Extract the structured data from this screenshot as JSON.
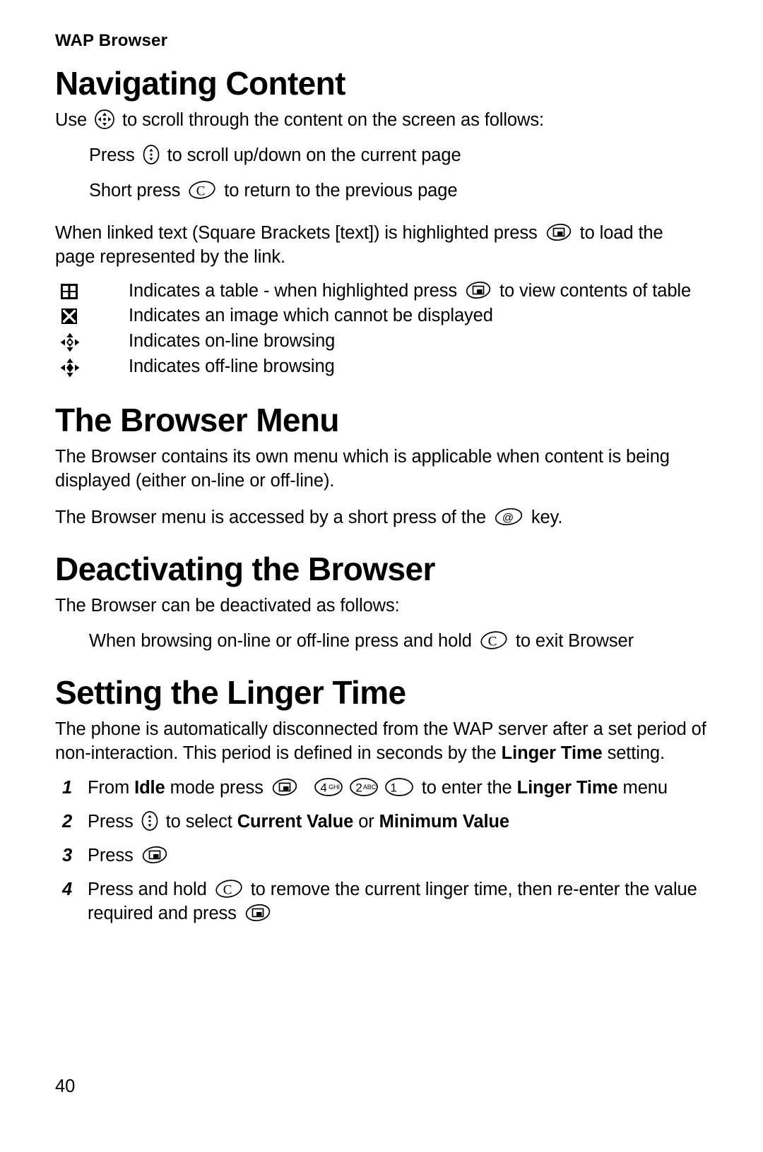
{
  "page": {
    "running_head": "WAP Browser",
    "page_number": "40"
  },
  "sections": [
    {
      "id": "navigating-content",
      "heading": "Navigating Content",
      "intro_before": "Use ",
      "intro_after": " to scroll through the content on the screen as follows:",
      "indent_items": [
        {
          "before": "Press ",
          "after": " to scroll up/down on the current page",
          "key": "updown"
        },
        {
          "before": "Short press ",
          "after": " to return to the previous page",
          "key": "clear-c"
        }
      ],
      "linked_text_before": "When linked text (Square Brackets [text]) is highlighted press ",
      "linked_text_after": " to load the page represented by the link.",
      "symbols": [
        {
          "icon": "table-grid-icon",
          "text_before": "Indicates a table - when highlighted press ",
          "text_after": " to view contents of table",
          "key": "select"
        },
        {
          "icon": "broken-image-icon",
          "text_before": "Indicates an image which cannot be displayed",
          "text_after": "",
          "key": ""
        },
        {
          "icon": "online-browsing-icon",
          "text_before": "Indicates on-line browsing",
          "text_after": "",
          "key": ""
        },
        {
          "icon": "offline-browsing-icon",
          "text_before": "Indicates off-line browsing",
          "text_after": "",
          "key": ""
        }
      ]
    },
    {
      "id": "the-browser-menu",
      "heading": "The Browser Menu",
      "paragraph_1": "The Browser contains its own menu which is applicable when content is being displayed (either on-line or off-line).",
      "paragraph_2_before": "The Browser menu is accessed by a short press of the ",
      "paragraph_2_after": " key."
    },
    {
      "id": "deactivating-the-browser",
      "heading": "Deactivating the Browser",
      "paragraph_1": "The Browser can be deactivated as follows:",
      "indent_before": "When browsing on-line or off-line press and hold ",
      "indent_after": " to exit Browser"
    },
    {
      "id": "setting-the-linger-time",
      "heading": "Setting the Linger Time",
      "paragraph_1_a": "The phone is automatically disconnected from the WAP server after a set period of non-interaction. This period is defined in seconds by the ",
      "paragraph_1_bold": "Linger Time",
      "paragraph_1_b": " setting.",
      "steps": [
        {
          "num": "1",
          "seg_1": "From ",
          "bold_1": "Idle",
          "seg_2": " mode press ",
          "seg_3": " to enter the ",
          "bold_2": "Linger Time",
          "seg_4": " menu"
        },
        {
          "num": "2",
          "seg_1": "Press ",
          "seg_2": " to select ",
          "bold_1": "Current Value",
          "seg_3": " or ",
          "bold_2": "Minimum Value"
        },
        {
          "num": "3",
          "seg_1": "Press "
        },
        {
          "num": "4",
          "seg_1": "Press and hold ",
          "seg_2": " to remove the current linger time, then re-enter the value required and press "
        }
      ]
    }
  ],
  "keys": {
    "navigate_4way": {
      "name": "navigation-key",
      "label": "4-way navigation key"
    },
    "updown": {
      "name": "updown-key",
      "label": "up/down scroll key"
    },
    "clear_c": {
      "name": "clear-key",
      "label": "C"
    },
    "select": {
      "name": "select-key",
      "label": "select key"
    },
    "at": {
      "name": "at-key",
      "label": "@"
    },
    "num4": {
      "name": "key-4",
      "digit": "4",
      "letters": "GHI"
    },
    "num2": {
      "name": "key-2",
      "digit": "2",
      "letters": "ABC"
    },
    "num1": {
      "name": "key-1",
      "digit": "1",
      "letters": ""
    }
  },
  "colors": {
    "ink": "#000000",
    "paper": "#ffffff"
  }
}
